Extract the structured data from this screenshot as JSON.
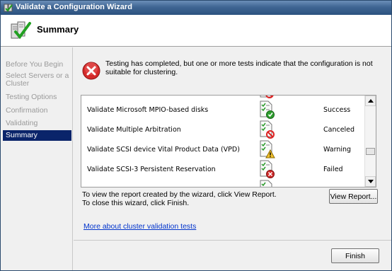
{
  "window": {
    "title": "Validate a Configuration Wizard"
  },
  "header": {
    "title": "Summary",
    "icon": "cluster-validation-icon"
  },
  "nav": {
    "items": [
      {
        "label": "Before You Begin",
        "selected": false
      },
      {
        "label": "Select Servers or a Cluster",
        "selected": false
      },
      {
        "label": "Testing Options",
        "selected": false
      },
      {
        "label": "Confirmation",
        "selected": false
      },
      {
        "label": "Validating",
        "selected": false
      },
      {
        "label": "Summary",
        "selected": true
      }
    ]
  },
  "status": {
    "icon": "error-icon",
    "message": "Testing has completed, but one or more tests indicate that the configuration is not suitable for clustering."
  },
  "results": {
    "rows": [
      {
        "name": "Validate Microsoft MPIO-based disks",
        "result": "Success",
        "icon": "success-icon"
      },
      {
        "name": "Validate Multiple Arbitration",
        "result": "Canceled",
        "icon": "canceled-icon"
      },
      {
        "name": "Validate SCSI device Vital Product Data (VPD)",
        "result": "Warning",
        "icon": "warning-icon"
      },
      {
        "name": "Validate SCSI-3 Persistent Reservation",
        "result": "Failed",
        "icon": "failed-icon"
      }
    ]
  },
  "report": {
    "line1": "To view the report created by the wizard, click View Report.",
    "line2": "To close this wizard, click Finish.",
    "view_button": "View Report..."
  },
  "link": {
    "label": "More about cluster validation tests"
  },
  "footer": {
    "finish_button": "Finish"
  },
  "colors": {
    "nav_selected": "#0a246a",
    "link": "#0033cc",
    "error": "#cc2222",
    "success": "#2e9e2e"
  }
}
